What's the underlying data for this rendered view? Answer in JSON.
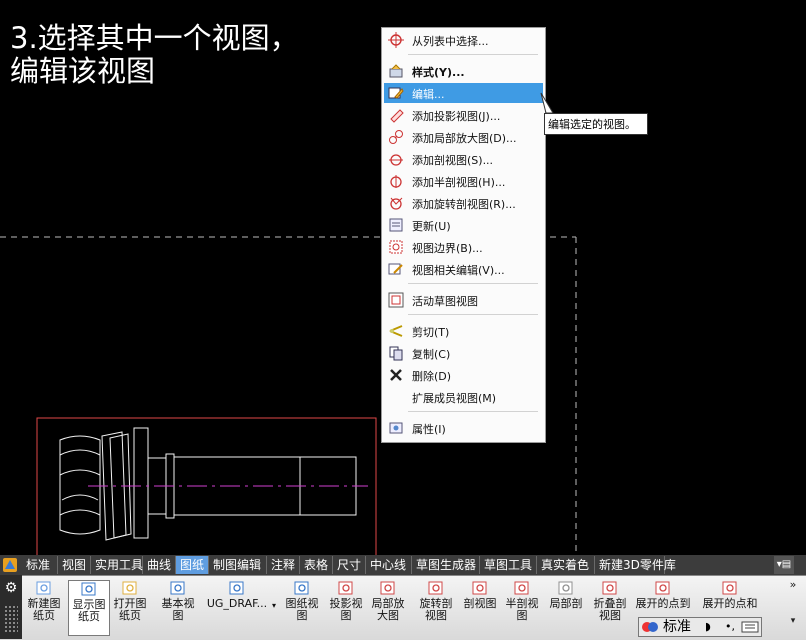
{
  "caption": {
    "line1": "3.选择其中一个视图，",
    "line2": "编辑该视图"
  },
  "context_menu": {
    "items": [
      {
        "label": "从列表中选择...",
        "icon": "crosshair-icon"
      },
      {
        "label": "样式(Y)...",
        "icon": "style-icon"
      },
      {
        "label": "编辑...",
        "icon": "edit-icon",
        "highlighted": true
      },
      {
        "label": "添加投影视图(J)...",
        "icon": "projected-view-icon"
      },
      {
        "label": "添加局部放大图(D)...",
        "icon": "detail-view-icon"
      },
      {
        "label": "添加剖视图(S)...",
        "icon": "section-view-icon"
      },
      {
        "label": "添加半剖视图(H)...",
        "icon": "half-section-icon"
      },
      {
        "label": "添加旋转剖视图(R)...",
        "icon": "revolved-section-icon"
      },
      {
        "label": "更新(U)",
        "icon": "update-icon"
      },
      {
        "label": "视图边界(B)...",
        "icon": "view-boundary-icon"
      },
      {
        "label": "视图相关编辑(V)...",
        "icon": "view-dependent-edit-icon"
      },
      {
        "label": "活动草图视图",
        "icon": "active-sketch-view-icon"
      },
      {
        "label": "剪切(T)",
        "icon": "cut-icon"
      },
      {
        "label": "复制(C)",
        "icon": "copy-icon"
      },
      {
        "label": "删除(D)",
        "icon": "delete-icon"
      },
      {
        "label": "扩展成员视图(M)",
        "icon": ""
      },
      {
        "label": "属性(I)",
        "icon": "properties-icon"
      }
    ]
  },
  "tooltip": {
    "text": "编辑选定的视图。"
  },
  "tabs": [
    "标准",
    "视图",
    "实用工具",
    "曲线",
    "图纸",
    "制图编辑",
    "注释",
    "表格",
    "尺寸",
    "中心线",
    "草图生成器",
    "草图工具",
    "真实着色",
    "新建3D零件库"
  ],
  "active_tab": "图纸",
  "toolbar": {
    "buttons": [
      {
        "line1": "新建图",
        "line2": "纸页",
        "icon": "new-sheet-icon"
      },
      {
        "line1": "显示图",
        "line2": "纸页",
        "icon": "display-sheet-icon",
        "selected": true
      },
      {
        "line1": "打开图",
        "line2": "纸页",
        "icon": "open-sheet-icon"
      },
      {
        "line1": "基本视",
        "line2": "图",
        "icon": "base-view-icon"
      },
      {
        "line1": "UG_DRAF...",
        "line2": "",
        "icon": "ug-draft-icon"
      },
      {
        "line1": "图纸视",
        "line2": "图",
        "icon": "drawing-view-icon"
      },
      {
        "line1": "投影视",
        "line2": "图",
        "icon": "projected-view-icon"
      },
      {
        "line1": "局部放",
        "line2": "大图",
        "icon": "detail-view-icon"
      },
      {
        "line1": "旋转剖",
        "line2": "视图",
        "icon": "revolved-section-icon"
      },
      {
        "line1": "剖视图",
        "line2": "",
        "icon": "section-view-icon"
      },
      {
        "line1": "半剖视",
        "line2": "图",
        "icon": "half-section-icon"
      },
      {
        "line1": "局部剖",
        "line2": "",
        "icon": "breakout-section-icon"
      },
      {
        "line1": "折叠剖",
        "line2": "视图",
        "icon": "folded-section-icon"
      },
      {
        "line1": "展开的点到",
        "line2": "",
        "icon": "unfolded-point-icon"
      },
      {
        "line1": "展开的点和",
        "line2": "",
        "icon": "unfolded-point-angle-icon"
      }
    ]
  },
  "ime": {
    "mode": "标准"
  }
}
